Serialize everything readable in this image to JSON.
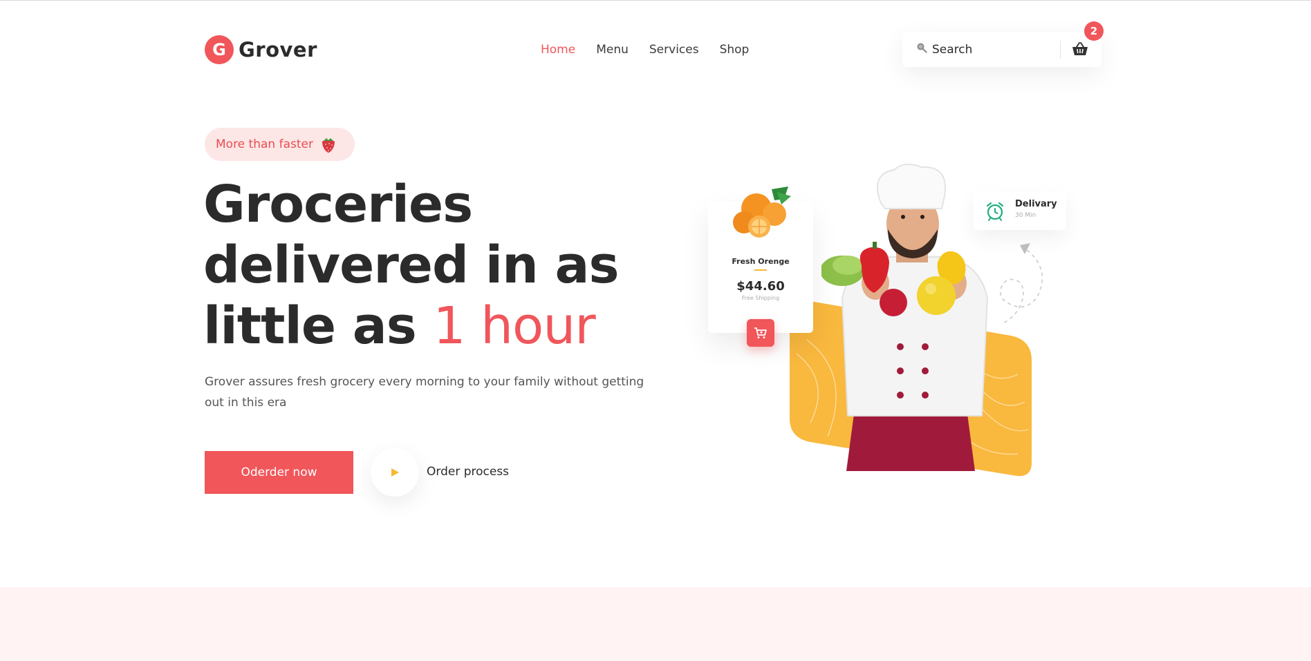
{
  "brand": {
    "name": "Grover",
    "logo_letter": "G",
    "accent_color": "#f0565a",
    "secondary_color": "#f7b733"
  },
  "nav": {
    "items": [
      {
        "label": "Home",
        "active": true
      },
      {
        "label": "Menu",
        "active": false
      },
      {
        "label": "Services",
        "active": false
      },
      {
        "label": "Shop",
        "active": false
      }
    ]
  },
  "search": {
    "placeholder": "Search",
    "icon": "search-icon"
  },
  "cart": {
    "count": "2",
    "icon": "basket-icon"
  },
  "hero": {
    "pill": "More than faster",
    "headline_line1": "Groceries",
    "headline_line2": "delivered in as",
    "headline_line3_prefix": "little as ",
    "headline_accent": "1 hour",
    "description": "Grover assures fresh grocery every morning to your family without getting out in this era",
    "cta_label": "Oderder now",
    "secondary_label": "Order process"
  },
  "product_card": {
    "name": "Fresh Orenge",
    "price": "$44.60",
    "shipping": "Free Shipping"
  },
  "delivery_card": {
    "title": "Delivary",
    "subtitle": "30 Min"
  }
}
